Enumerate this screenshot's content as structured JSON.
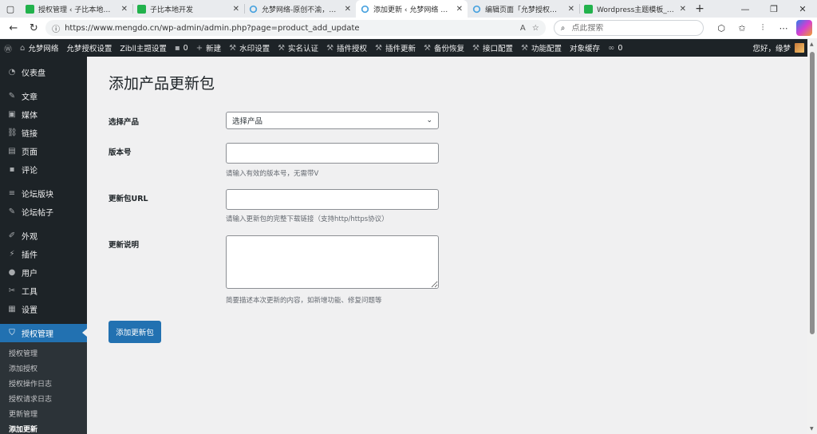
{
  "browser": {
    "tabs": [
      {
        "title": "授权管理 ‹ 子比本地开发 — ",
        "favicon": "green-leaf-icon",
        "active": false
      },
      {
        "title": "子比本地开发",
        "favicon": "green-leaf-icon",
        "active": false
      },
      {
        "title": "允梦网络-原创不渝，臻求际",
        "favicon": "blue-ring-icon",
        "active": false
      },
      {
        "title": "添加更新 ‹ 允梦网络 — Wor",
        "favicon": "blue-ring-icon",
        "active": true
      },
      {
        "title": "编辑页面「允梦授权插件列",
        "favicon": "blue-ring-icon",
        "active": false
      },
      {
        "title": "Wordpress主题模板_zibll主",
        "favicon": "green-leaf-icon",
        "active": false
      }
    ],
    "url": "https://www.mengdo.cn/wp-admin/admin.php?page=product_add_update",
    "search_placeholder": "点此搜索"
  },
  "adminbar": {
    "items": [
      {
        "icon": "wordpress-logo-icon",
        "label": ""
      },
      {
        "icon": "home-icon",
        "label": "允梦网络"
      },
      {
        "icon": "",
        "label": "允梦授权设置"
      },
      {
        "icon": "",
        "label": "Zibll主题设置"
      },
      {
        "icon": "comment-icon",
        "label": "0"
      },
      {
        "icon": "plus-icon",
        "label": "新建"
      },
      {
        "icon": "tool-icon",
        "label": "水印设置"
      },
      {
        "icon": "tool-icon",
        "label": "实名认证"
      },
      {
        "icon": "tool-icon",
        "label": "插件授权"
      },
      {
        "icon": "tool-icon",
        "label": "插件更新"
      },
      {
        "icon": "tool-icon",
        "label": "备份恢复"
      },
      {
        "icon": "tool-icon",
        "label": "接口配置"
      },
      {
        "icon": "tool-icon",
        "label": "功能配置"
      },
      {
        "icon": "",
        "label": "对象缓存"
      },
      {
        "icon": "link-icon",
        "label": "0"
      }
    ],
    "greeting": "您好，缘梦"
  },
  "sidebar": {
    "menu": [
      {
        "icon": "dashboard-icon",
        "label": "仪表盘",
        "sep_after": true
      },
      {
        "icon": "pin-icon",
        "label": "文章"
      },
      {
        "icon": "media-icon",
        "label": "媒体"
      },
      {
        "icon": "link-icon",
        "label": "链接"
      },
      {
        "icon": "page-icon",
        "label": "页面"
      },
      {
        "icon": "comment-icon",
        "label": "评论",
        "sep_after": true
      },
      {
        "icon": "forum-icon",
        "label": "论坛版块"
      },
      {
        "icon": "topic-icon",
        "label": "论坛帖子",
        "sep_after": true
      },
      {
        "icon": "appearance-icon",
        "label": "外观"
      },
      {
        "icon": "plugin-icon",
        "label": "插件"
      },
      {
        "icon": "user-icon",
        "label": "用户"
      },
      {
        "icon": "wrench-icon",
        "label": "工具"
      },
      {
        "icon": "settings-icon",
        "label": "设置",
        "sep_after": true
      },
      {
        "icon": "shield-icon",
        "label": "授权管理",
        "current": true
      }
    ],
    "submenu": [
      {
        "label": "授权管理"
      },
      {
        "label": "添加授权"
      },
      {
        "label": "授权操作日志"
      },
      {
        "label": "授权请求日志"
      },
      {
        "label": "更新管理"
      },
      {
        "label": "添加更新",
        "current": true
      }
    ]
  },
  "main": {
    "title": "添加产品更新包",
    "product": {
      "label": "选择产品",
      "selected": "选择产品"
    },
    "version": {
      "label": "版本号",
      "value": "",
      "help": "请输入有效的版本号，无需带V"
    },
    "package_url": {
      "label": "更新包URL",
      "value": "",
      "help": "请输入更新包的完整下载链接（支持http/https协议）"
    },
    "notes": {
      "label": "更新说明",
      "value": "",
      "help": "简要描述本次更新的内容，如新增功能、修复问题等"
    },
    "submit_label": "添加更新包"
  },
  "icons": {
    "tab_actions": "▢",
    "new_tab": "+",
    "minimize": "—",
    "maximize": "❐",
    "close": "✕",
    "back": "←",
    "reload": "↻",
    "site_info": "ⓘ",
    "read_aloud": "A",
    "favorite": "☆",
    "search": "⌕",
    "extensions": "⬡",
    "favorites_bar": "✩",
    "split": "⫶",
    "more": "⋯",
    "admin_wp": "Ⓦ",
    "admin_home": "⌂",
    "admin_comment": "▪",
    "admin_plus": "+",
    "admin_tool": "⚒",
    "admin_link": "∞",
    "dashboard": "◔",
    "pin": "✎",
    "media": "▣",
    "link": "⛓",
    "page": "▤",
    "comment": "▪",
    "forum": "≡",
    "topic": "✎",
    "appearance": "✐",
    "plugin": "⚡",
    "user": "●",
    "wrench": "✂",
    "settings": "▦",
    "shield": "⛉",
    "select_caret": "⌄",
    "scroll_up": "▲",
    "scroll_down": "▼"
  }
}
